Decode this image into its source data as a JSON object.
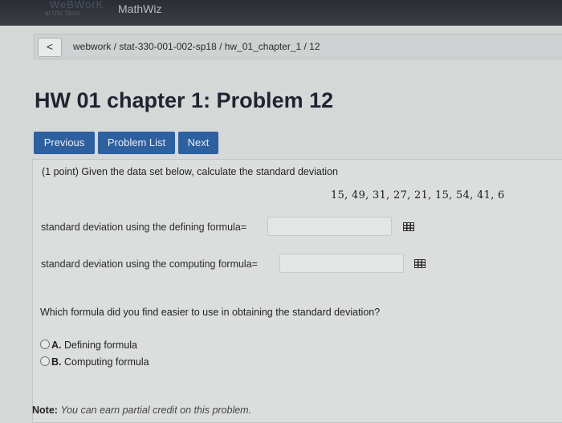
{
  "header": {
    "logo_text": "WeBWorK",
    "logo_sub": "at UW Stout",
    "app_name": "MathWiz"
  },
  "breadcrumb": {
    "back_glyph": "<",
    "path": "webwork / stat-330-001-002-sp18 / hw_01_chapter_1 / 12"
  },
  "page": {
    "title": "HW 01 chapter 1: Problem 12"
  },
  "nav": {
    "previous": "Previous",
    "problem_list": "Problem List",
    "next": "Next"
  },
  "problem": {
    "prompt": "(1 point) Given the data set below, calculate the standard deviation",
    "dataset": "15, 49, 31, 27, 21, 15, 54, 41, 6",
    "q1_label": "standard deviation using the defining formula=",
    "q1_value": "",
    "q2_label": "standard deviation using the computing formula=",
    "q2_value": "",
    "question": "Which formula did you find easier to use in obtaining the standard deviation?",
    "options": [
      {
        "letter": "A.",
        "text": "Defining formula"
      },
      {
        "letter": "B.",
        "text": "Computing formula"
      }
    ]
  },
  "footer": {
    "note_label": "Note:",
    "note_text": "You can earn partial credit on this problem."
  },
  "colors": {
    "nav_button": "#2e5f9e",
    "topbar": "#2a2d33"
  }
}
